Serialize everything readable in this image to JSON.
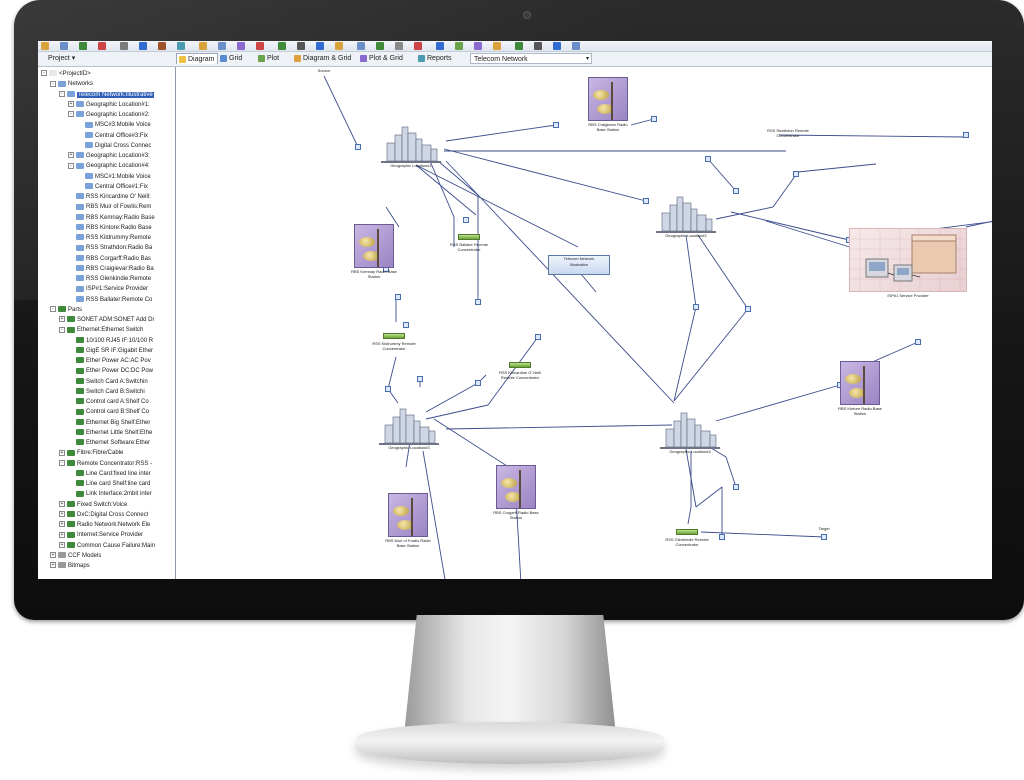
{
  "project_dropdown": "Project",
  "tabs": [
    "Diagram",
    "Grid",
    "Plot",
    "Diagram & Grid",
    "Plot & Grid",
    "Reports"
  ],
  "network_select": "Telecom Network",
  "tree": [
    {
      "label": "<ProjectID>",
      "indent": 0,
      "exp": "-",
      "color": "#e8e8e8"
    },
    {
      "label": "Networks",
      "indent": 1,
      "exp": "-",
      "color": "#7aa2d8"
    },
    {
      "label": "Telecom Network:Illustrative",
      "indent": 2,
      "exp": "-",
      "color": "#7aa2d8",
      "selected": true
    },
    {
      "label": "Geographic Location#1:",
      "indent": 3,
      "exp": "+",
      "color": "#7aa2d8"
    },
    {
      "label": "Geographic Location#2:",
      "indent": 3,
      "exp": "-",
      "color": "#7aa2d8"
    },
    {
      "label": "MSC#3:Mobile Voice",
      "indent": 4,
      "exp": "",
      "color": "#7aa2d8"
    },
    {
      "label": "Central Office#3:Fix",
      "indent": 4,
      "exp": "",
      "color": "#7aa2d8"
    },
    {
      "label": "Digital Cross Connec",
      "indent": 4,
      "exp": "",
      "color": "#7aa2d8"
    },
    {
      "label": "Geographic Location#3:",
      "indent": 3,
      "exp": "+",
      "color": "#7aa2d8"
    },
    {
      "label": "Geographic Location#4:",
      "indent": 3,
      "exp": "-",
      "color": "#7aa2d8"
    },
    {
      "label": "MSC#1:Mobile Voice",
      "indent": 4,
      "exp": "",
      "color": "#7aa2d8"
    },
    {
      "label": "Central Office#1:Fix",
      "indent": 4,
      "exp": "",
      "color": "#7aa2d8"
    },
    {
      "label": "RSS Kincardine O' Neill:",
      "indent": 3,
      "exp": "",
      "color": "#7aa2d8"
    },
    {
      "label": "RBS Muir of Fowlis:Rem",
      "indent": 3,
      "exp": "",
      "color": "#7aa2d8"
    },
    {
      "label": "RBS Kemnay:Radio Base",
      "indent": 3,
      "exp": "",
      "color": "#7aa2d8"
    },
    {
      "label": "RBS Kintore:Radio Base",
      "indent": 3,
      "exp": "",
      "color": "#7aa2d8"
    },
    {
      "label": "RSS Kildrummy:Remote",
      "indent": 3,
      "exp": "",
      "color": "#7aa2d8"
    },
    {
      "label": "RSS Strathdon:Radio Ba",
      "indent": 3,
      "exp": "",
      "color": "#7aa2d8"
    },
    {
      "label": "RBS Corgarff:Radio Bas",
      "indent": 3,
      "exp": "",
      "color": "#7aa2d8"
    },
    {
      "label": "RBS Craigievar:Radio Ba",
      "indent": 3,
      "exp": "",
      "color": "#7aa2d8"
    },
    {
      "label": "RSS Glenkindie:Remote",
      "indent": 3,
      "exp": "",
      "color": "#7aa2d8"
    },
    {
      "label": "ISP#1:Service Provider",
      "indent": 3,
      "exp": "",
      "color": "#7aa2d8"
    },
    {
      "label": "RSS Ballater:Remote Co",
      "indent": 3,
      "exp": "",
      "color": "#7aa2d8"
    },
    {
      "label": "Parts",
      "indent": 1,
      "exp": "-",
      "color": "#3f8a3a"
    },
    {
      "label": "SONET ADM:SONET Add Dr",
      "indent": 2,
      "exp": "+",
      "color": "#3f8a3a"
    },
    {
      "label": "Ethernet:Ethernet Switch",
      "indent": 2,
      "exp": "-",
      "color": "#3f8a3a"
    },
    {
      "label": "10/100 RJ45 IF:10/100 R",
      "indent": 3,
      "exp": "",
      "color": "#3f8a3a"
    },
    {
      "label": "GigE SR IF:Gigabit Ether",
      "indent": 3,
      "exp": "",
      "color": "#3f8a3a"
    },
    {
      "label": "Ether Power AC:AC Pov",
      "indent": 3,
      "exp": "",
      "color": "#3f8a3a"
    },
    {
      "label": "Ether Power DC:DC Pow",
      "indent": 3,
      "exp": "",
      "color": "#3f8a3a"
    },
    {
      "label": "Switch Card A:Switchin",
      "indent": 3,
      "exp": "",
      "color": "#3f8a3a"
    },
    {
      "label": "Switch Card B:Switchi",
      "indent": 3,
      "exp": "",
      "color": "#3f8a3a"
    },
    {
      "label": "Control card A:Shelf Co",
      "indent": 3,
      "exp": "",
      "color": "#3f8a3a"
    },
    {
      "label": "Control card B:Shelf Co",
      "indent": 3,
      "exp": "",
      "color": "#3f8a3a"
    },
    {
      "label": "Ethernet Big Shelf:Ether",
      "indent": 3,
      "exp": "",
      "color": "#3f8a3a"
    },
    {
      "label": "Ethernet Little Shelf:Ethe",
      "indent": 3,
      "exp": "",
      "color": "#3f8a3a"
    },
    {
      "label": "Ethernet Software:Ether",
      "indent": 3,
      "exp": "",
      "color": "#3f8a3a"
    },
    {
      "label": "Fibre:Fibre/Cable",
      "indent": 2,
      "exp": "+",
      "color": "#3f8a3a"
    },
    {
      "label": "Remote Concentrator:RSS -",
      "indent": 2,
      "exp": "-",
      "color": "#3f8a3a"
    },
    {
      "label": "Line Card:fixed line inter",
      "indent": 3,
      "exp": "",
      "color": "#3f8a3a"
    },
    {
      "label": "Line card Shelf:line card",
      "indent": 3,
      "exp": "",
      "color": "#3f8a3a"
    },
    {
      "label": "Link Interface:2mbit inter",
      "indent": 3,
      "exp": "",
      "color": "#3f8a3a"
    },
    {
      "label": "Fixed Switch:Voice",
      "indent": 2,
      "exp": "+",
      "color": "#3f8a3a"
    },
    {
      "label": "DxC:Digital Cross Connect",
      "indent": 2,
      "exp": "+",
      "color": "#3f8a3a"
    },
    {
      "label": "Radio Network:Network Ele",
      "indent": 2,
      "exp": "+",
      "color": "#3f8a3a"
    },
    {
      "label": "Internet:Service Provider",
      "indent": 2,
      "exp": "+",
      "color": "#3f8a3a"
    },
    {
      "label": "Common Cause Failure:Main",
      "indent": 2,
      "exp": "+",
      "color": "#3f8a3a"
    },
    {
      "label": "CCF Models",
      "indent": 1,
      "exp": "+",
      "color": "#999999"
    },
    {
      "label": "Bitmaps",
      "indent": 1,
      "exp": "+",
      "color": "#999999"
    }
  ],
  "diagram": {
    "cities": [
      {
        "label": "Geographic Location#1"
      },
      {
        "label": "Geographic Location#2"
      },
      {
        "label": "Geographic Location#3"
      },
      {
        "label": "Geographic Location#4"
      }
    ],
    "towers": [
      {
        "label": "RBS Craigievar Radio Base Station"
      },
      {
        "label": "RBS Kemnay Radio Base Station"
      },
      {
        "label": "RBS Kintore Radio Base Station"
      },
      {
        "label": "RBS Corgarff Radio Base Station"
      },
      {
        "label": "RBS Muir of Fowlis Radio Base Station"
      }
    ],
    "switches": [
      {
        "label": "RSS Ballater Remote Concentrator"
      },
      {
        "label": "RSS Kildrummy Remote Concentrator"
      },
      {
        "label": "RSS Kincardine O' Neill Remote Concentrator"
      },
      {
        "label": "RSS Glenkindie Remote Concentrator"
      }
    ],
    "service_box": {
      "title": "Telecom Network",
      "subtitle": "Illustrative"
    },
    "provider_label": "ISP#1 Service Provider",
    "small_labels": [
      "Source",
      "Target",
      "RSS Strathdon Remote Concentrator"
    ]
  },
  "colors": {
    "link": "#3c4c8c",
    "selection": "#2f5fb8",
    "tower_bg": "#b09ad6"
  }
}
